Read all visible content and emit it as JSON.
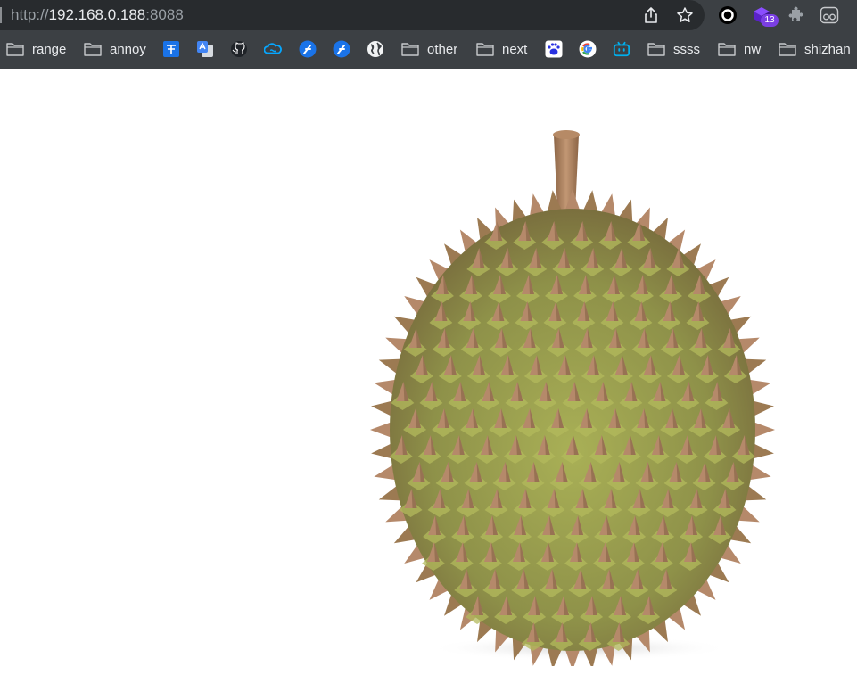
{
  "browser": {
    "url": {
      "scheme": "http://",
      "host": "192.168.0.188",
      "port": ":8088"
    },
    "actions": {
      "share_icon": "share-icon",
      "bookmark_star_icon": "star-icon"
    },
    "extensions": [
      {
        "name": "ring-extension-icon"
      },
      {
        "name": "cube-extension-icon",
        "badge": "13"
      },
      {
        "name": "puzzle-extension-icon"
      },
      {
        "name": "glasses-extension-icon"
      }
    ]
  },
  "bookmarks": [
    {
      "type": "folder",
      "label": "range"
    },
    {
      "type": "folder",
      "label": "annoy"
    },
    {
      "type": "icon",
      "icon": "translate-icon"
    },
    {
      "type": "icon",
      "icon": "google-translate-icon"
    },
    {
      "type": "icon",
      "icon": "github-icon"
    },
    {
      "type": "icon",
      "icon": "cloud-icon"
    },
    {
      "type": "icon",
      "icon": "feather-icon"
    },
    {
      "type": "icon",
      "icon": "feather-icon"
    },
    {
      "type": "icon",
      "icon": "globe-icon"
    },
    {
      "type": "folder",
      "label": "other"
    },
    {
      "type": "folder",
      "label": "next"
    },
    {
      "type": "icon",
      "icon": "baidu-icon"
    },
    {
      "type": "icon",
      "icon": "google-icon"
    },
    {
      "type": "icon",
      "icon": "bilibili-icon"
    },
    {
      "type": "folder",
      "label": "ssss"
    },
    {
      "type": "folder",
      "label": "nw"
    },
    {
      "type": "folder",
      "label": "shizhan"
    }
  ],
  "content": {
    "image": "durian",
    "colors": {
      "shell": "#9a9d4e",
      "spike_tip": "#b5896a",
      "stem": "#a97f5c"
    }
  }
}
